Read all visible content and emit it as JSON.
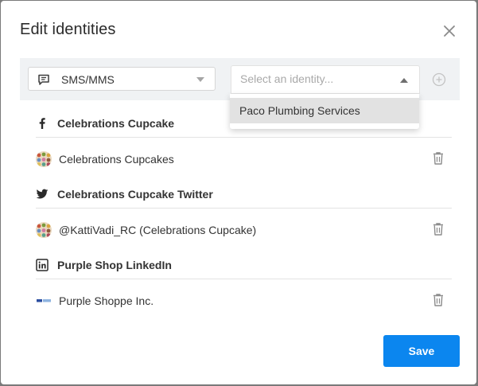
{
  "dialog": {
    "title": "Edit identities"
  },
  "toolbar": {
    "channel": {
      "value": "SMS/MMS",
      "icon": "chat-bubble-icon"
    },
    "identity_select": {
      "placeholder": "Select an identity..."
    },
    "add_icon": "plus-circle-icon"
  },
  "dropdown": {
    "options": [
      {
        "label": "Paco Plumbing Services",
        "highlighted": true
      }
    ]
  },
  "sections": [
    {
      "network": "facebook",
      "icon": "facebook-icon",
      "title": "Celebrations Cupcake",
      "identities": [
        {
          "name": "Celebrations Cupcakes"
        }
      ]
    },
    {
      "network": "twitter",
      "icon": "twitter-icon",
      "title": "Celebrations Cupcake Twitter",
      "identities": [
        {
          "name": "@KattiVadi_RC (Celebrations Cupcake)"
        }
      ]
    },
    {
      "network": "linkedin",
      "icon": "linkedin-icon",
      "title": "Purple Shop LinkedIn",
      "identities": [
        {
          "name": "Purple Shoppe Inc."
        }
      ]
    }
  ],
  "footer": {
    "save_label": "Save"
  },
  "colors": {
    "primary": "#0b86ef",
    "toolbar_bg": "#f0f2f4",
    "highlight": "#e2e2e2"
  }
}
